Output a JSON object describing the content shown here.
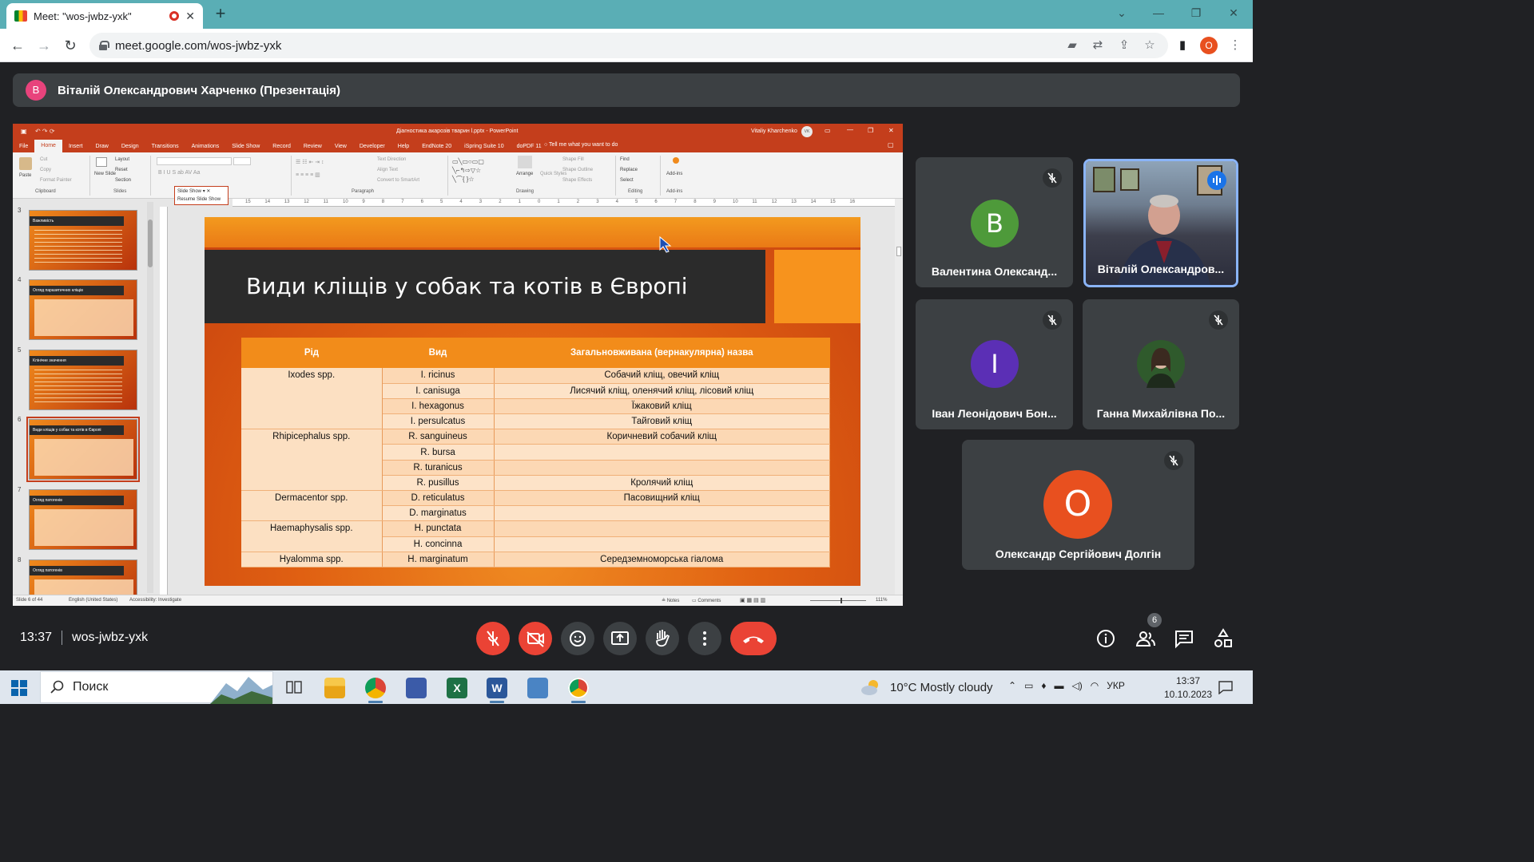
{
  "browser": {
    "tab_title": "Meet: \"wos-jwbz-yxk\"",
    "url": "meet.google.com/wos-jwbz-yxk",
    "profile_initial": "O"
  },
  "presenter_bar": {
    "initial": "В",
    "name": "Віталій Олександрович Харченко (Презентація)"
  },
  "powerpoint": {
    "window_title": "Діагностика акарозів тварин l.pptx  -  PowerPoint",
    "user": "Vitaliy Kharchenko",
    "user_initials": "VK",
    "tabs": [
      "File",
      "Home",
      "Insert",
      "Draw",
      "Design",
      "Transitions",
      "Animations",
      "Slide Show",
      "Record",
      "Review",
      "View",
      "Developer",
      "Help",
      "EndNote 20",
      "iSpring Suite 10",
      "doPDF 11"
    ],
    "active_tab": "Home",
    "tell_me": "Tell me what you want to do",
    "ribbon": {
      "clipboard": {
        "paste": "Paste",
        "cut": "Cut",
        "copy": "Copy",
        "format_painter": "Format Painter",
        "label": "Clipboard"
      },
      "slides": {
        "new_slide": "New Slide",
        "layout": "Layout",
        "reset": "Reset",
        "section": "Section",
        "label": "Slides"
      },
      "paragraph": {
        "text_direction": "Text Direction",
        "align_text": "Align Text",
        "convert": "Convert to SmartArt",
        "label": "Paragraph"
      },
      "drawing": {
        "arrange": "Arrange",
        "quick_styles": "Quick Styles",
        "shape_fill": "Shape Fill",
        "shape_outline": "Shape Outline",
        "shape_effects": "Shape Effects",
        "label": "Drawing"
      },
      "editing": {
        "find": "Find",
        "replace": "Replace",
        "select": "Select",
        "label": "Editing"
      },
      "addins": {
        "addins": "Add-ins",
        "label": "Add-ins"
      }
    },
    "slideshow_popup": {
      "dropdown": "Slide Show",
      "resume": "Resume Slide Show"
    },
    "ruler_numbers": [
      "15",
      "14",
      "13",
      "12",
      "11",
      "10",
      "9",
      "8",
      "7",
      "6",
      "5",
      "4",
      "3",
      "2",
      "1",
      "0",
      "1",
      "2",
      "3",
      "4",
      "5",
      "6",
      "7",
      "8",
      "9",
      "10",
      "11",
      "12",
      "13",
      "14",
      "15",
      "16"
    ],
    "thumbnails": [
      {
        "num": "3",
        "title": "Важливість"
      },
      {
        "num": "4",
        "title": "Огляд паразитичних кліщів"
      },
      {
        "num": "5",
        "title": "Клінічне значення"
      },
      {
        "num": "6",
        "title": "Види кліщів у собак та котів в Європі"
      },
      {
        "num": "7",
        "title": "Огляд патогенів"
      },
      {
        "num": "8",
        "title": "Огляд патогенів"
      }
    ],
    "selected_slide": "6",
    "status": {
      "slide_of": "Slide 6 of 44",
      "language": "English (United States)",
      "accessibility": "Accessibility: Investigate",
      "notes": "Notes",
      "comments": "Comments",
      "zoom": "111%"
    }
  },
  "slide": {
    "title": "Види кліщів у собак та котів в Європі",
    "headers": [
      "Рід",
      "Вид",
      "Загальновживана (вернакулярна) назва"
    ],
    "groups": [
      {
        "genus": "Ixodes spp.",
        "rows": [
          {
            "species": "I. ricinus",
            "name": "Собачий кліщ, овечий кліщ"
          },
          {
            "species": "I. canisuga",
            "name": "Лисячий кліщ, оленячий кліщ, лісовий кліщ"
          },
          {
            "species": "I. hexagonus",
            "name": "Їжаковий кліщ"
          },
          {
            "species": "I. persulcatus",
            "name": "Тайговий кліщ"
          }
        ]
      },
      {
        "genus": "Rhipicephalus spp.",
        "rows": [
          {
            "species": "R. sanguineus",
            "name": "Коричневий собачий кліщ"
          },
          {
            "species": "R. bursa",
            "name": ""
          },
          {
            "species": "R. turanicus",
            "name": ""
          },
          {
            "species": "R. pusillus",
            "name": "Кролячий кліщ"
          }
        ]
      },
      {
        "genus": "Dermacentor spp.",
        "rows": [
          {
            "species": "D. reticulatus",
            "name": "Пасовищний кліщ"
          },
          {
            "species": "D. marginatus",
            "name": ""
          }
        ]
      },
      {
        "genus": "Haemaphysalis spp.",
        "rows": [
          {
            "species": "H. punctata",
            "name": ""
          },
          {
            "species": "H. concinna",
            "name": ""
          }
        ]
      },
      {
        "genus": "Hyalomma spp.",
        "rows": [
          {
            "species": "H. marginatum",
            "name": "Середземноморська гіалома"
          }
        ]
      }
    ]
  },
  "participants": [
    {
      "initial": "В",
      "name": "Валентина Олександ...",
      "color": "#4e9a3a",
      "muted": true
    },
    {
      "initial": "",
      "name": "Віталій Олександров...",
      "video": true,
      "speaking": true
    },
    {
      "initial": "І",
      "name": "Іван Леонідович Бон...",
      "color": "#5b2fb5",
      "muted": true
    },
    {
      "initial": "",
      "name": "Ганна Михайлівна По...",
      "photo": true,
      "muted": true
    },
    {
      "initial": "О",
      "name": "Олександр Сергійович Долгін",
      "color": "#e8501f",
      "muted": true
    }
  ],
  "meet_footer": {
    "time": "13:37",
    "code": "wos-jwbz-yxk",
    "people_count": "6"
  },
  "taskbar": {
    "search_placeholder": "Поиск",
    "weather": "10°C  Mostly cloudy",
    "lang": "УКР",
    "time": "13:37",
    "date": "10.10.2023"
  },
  "colors": {
    "tab_bar": "#5aaeb5",
    "ppt_accent": "#c43e1c",
    "meet_bg": "#202124",
    "leave_red": "#ea4335"
  }
}
